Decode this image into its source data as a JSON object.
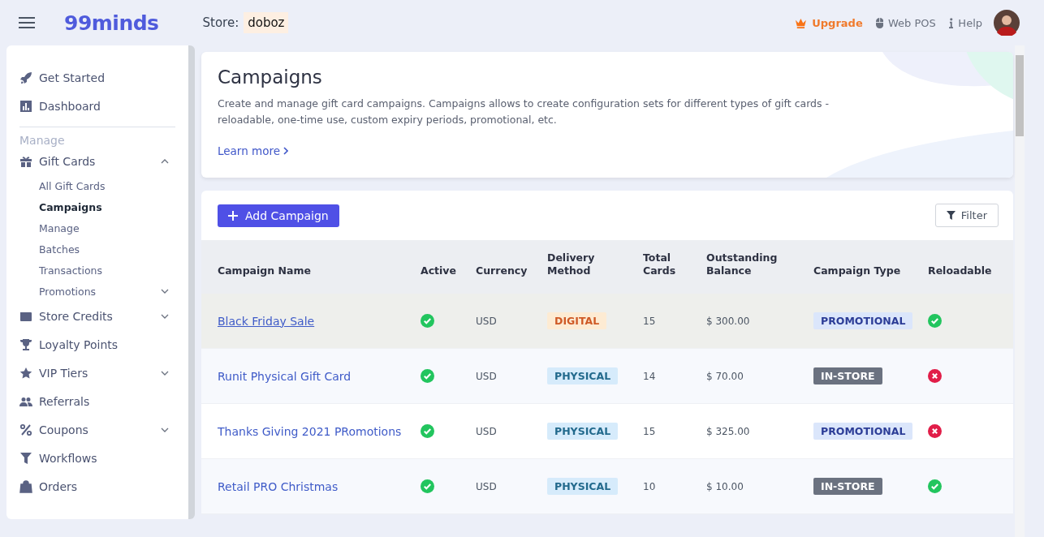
{
  "header": {
    "logo": "99minds",
    "store_label": "Store:",
    "store_name": "doboz",
    "actions": [
      {
        "kind": "upgrade",
        "label": "Upgrade"
      },
      {
        "kind": "pos",
        "label": "Web POS"
      },
      {
        "kind": "help",
        "label": "Help"
      }
    ]
  },
  "sidebar": {
    "top_items": [
      {
        "label": "Get Started"
      },
      {
        "label": "Dashboard"
      }
    ],
    "section": "Manage",
    "items": [
      {
        "kind": "group",
        "label": "Gift Cards",
        "expanded": true,
        "children": [
          {
            "kind": "link",
            "label": "All Gift Cards",
            "selected": false
          },
          {
            "kind": "link",
            "label": "Campaigns",
            "selected": true
          },
          {
            "kind": "link",
            "label": "Manage",
            "selected": false
          },
          {
            "kind": "link",
            "label": "Batches",
            "selected": false
          },
          {
            "kind": "link",
            "label": "Transactions",
            "selected": false
          },
          {
            "kind": "group",
            "label": "Promotions",
            "selected": false,
            "expanded": false
          }
        ]
      },
      {
        "kind": "group",
        "label": "Store Credits",
        "expanded": false
      },
      {
        "kind": "link",
        "label": "Loyalty Points"
      },
      {
        "kind": "group",
        "label": "VIP Tiers",
        "expanded": false
      },
      {
        "kind": "link",
        "label": "Referrals"
      },
      {
        "kind": "group",
        "label": "Coupons",
        "expanded": false
      },
      {
        "kind": "link",
        "label": "Workflows"
      },
      {
        "kind": "link",
        "label": "Orders"
      }
    ]
  },
  "intro": {
    "title": "Campaigns",
    "description": "Create and manage gift card campaigns. Campaigns allows to create configuration sets for different types of gift cards - reloadable, one-time use, custom expiry periods, promotional, etc.",
    "link": "Learn more"
  },
  "toolbar": {
    "add_button": "Add Campaign",
    "filter_button": "Filter"
  },
  "table": {
    "columns": [
      "Campaign Name",
      "Active",
      "Currency",
      "Delivery Method",
      "Total Cards",
      "Outstanding Balance",
      "Campaign Type",
      "Reloadable"
    ],
    "rows": [
      {
        "name": "Black Friday Sale",
        "highlighted": true,
        "active": true,
        "currency": "USD",
        "delivery": {
          "kind": "digital",
          "label": "DIGITAL"
        },
        "total": "15",
        "balance": "$ 300.00",
        "type": {
          "kind": "promotional",
          "label": "PROMOTIONAL"
        },
        "reloadable": true
      },
      {
        "name": "Runit Physical Gift Card",
        "highlighted": false,
        "active": true,
        "currency": "USD",
        "delivery": {
          "kind": "physical",
          "label": "PHYSICAL"
        },
        "total": "14",
        "balance": "$ 70.00",
        "type": {
          "kind": "instore",
          "label": "IN-STORE"
        },
        "reloadable": false
      },
      {
        "name": "Thanks Giving 2021 PRomotions",
        "highlighted": false,
        "active": true,
        "currency": "USD",
        "delivery": {
          "kind": "physical",
          "label": "PHYSICAL"
        },
        "total": "15",
        "balance": "$ 325.00",
        "type": {
          "kind": "promotional",
          "label": "PROMOTIONAL"
        },
        "reloadable": false
      },
      {
        "name": "Retail PRO Christmas",
        "highlighted": false,
        "active": true,
        "currency": "USD",
        "delivery": {
          "kind": "physical",
          "label": "PHYSICAL"
        },
        "total": "10",
        "balance": "$ 10.00",
        "type": {
          "kind": "instore",
          "label": "IN-STORE"
        },
        "reloadable": true
      }
    ]
  }
}
